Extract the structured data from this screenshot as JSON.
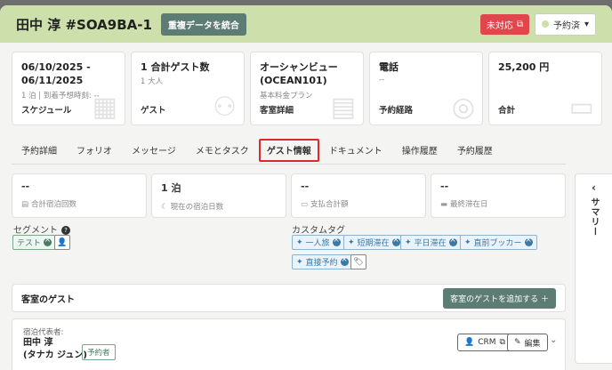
{
  "header": {
    "title": "田中 淳 #SOA9BA-1",
    "merge_label": "重複データを統合",
    "unresolved_label": "未対応",
    "status_label": "予約済",
    "status_color": "#cddfaa"
  },
  "cards": [
    {
      "value": "06/10/2025 -\n06/11/2025",
      "sub": "1 泊 | 到着予想時刻: --",
      "footer": "スケジュール",
      "icon": "calendar-icon"
    },
    {
      "value": "1 合計ゲスト数",
      "sub": "1 大人",
      "footer": "ゲスト",
      "icon": "people-icon"
    },
    {
      "value": "オーシャンビュー\n(OCEAN101)",
      "sub": "基本料金プラン",
      "footer": "客室詳細",
      "icon": "building-icon"
    },
    {
      "value": "電話",
      "sub": "--",
      "footer": "予約経路",
      "icon": "target-icon"
    },
    {
      "value": "25,200 円",
      "sub": "",
      "footer": "合計",
      "icon": "money-icon"
    }
  ],
  "tabs": [
    "予約詳細",
    "フォリオ",
    "メッセージ",
    "メモとタスク",
    "ゲスト情報",
    "ドキュメント",
    "操作履歴",
    "予約履歴"
  ],
  "active_tab": "ゲスト情報",
  "stats": [
    {
      "value": "--",
      "label": "合計宿泊回数",
      "icon": "list-icon"
    },
    {
      "value": "1 泊",
      "label": "現在の宿泊日数",
      "icon": "moon-icon"
    },
    {
      "value": "--",
      "label": "支払合計額",
      "icon": "cash-icon"
    },
    {
      "value": "--",
      "label": "最終滞在日",
      "icon": "bed-icon"
    }
  ],
  "summary_label": "サマリー",
  "segments": {
    "label": "セグメント",
    "items": [
      "テスト"
    ]
  },
  "custom_tags": {
    "label": "カスタムタグ",
    "items": [
      "一人旅",
      "短期滞在",
      "平日滞在",
      "直前ブッカー",
      "直接予約"
    ]
  },
  "guests": {
    "title": "客室のゲスト",
    "add_label": "客室のゲストを追加する ＋"
  },
  "representative": {
    "label": "宿泊代表者:",
    "name": "田中 淳",
    "kana": "(タナカ ジュン)",
    "badge": "予約者",
    "crm_label": "CRM",
    "edit_label": "編集"
  }
}
